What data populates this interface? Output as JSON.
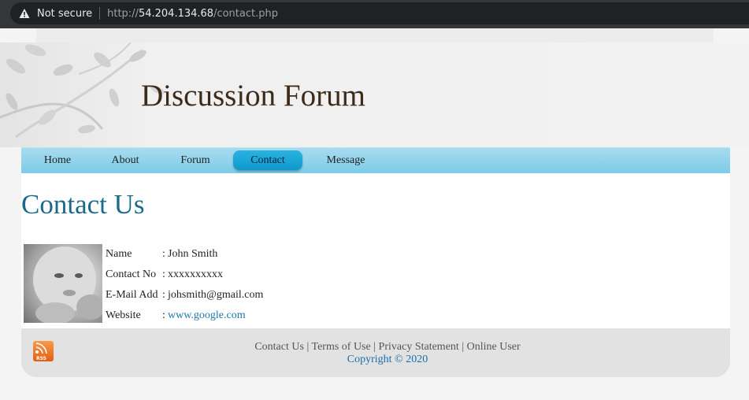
{
  "browser": {
    "security_label": "Not secure",
    "url_scheme": "http://",
    "url_host": "54.204.134.68",
    "url_path": "/contact.php"
  },
  "site": {
    "title": "Discussion Forum"
  },
  "nav": {
    "items": [
      {
        "label": "Home"
      },
      {
        "label": "About"
      },
      {
        "label": "Forum"
      },
      {
        "label": "Contact"
      },
      {
        "label": "Message"
      }
    ],
    "active": "Contact",
    "accent": "#1aa6d8"
  },
  "main": {
    "title": "Contact Us",
    "contact": {
      "name_label": "Name",
      "name_value": "John Smith",
      "phone_label": "Contact No",
      "phone_value": "xxxxxxxxxx",
      "email_label": "E-Mail Add",
      "email_value": "johsmith@gmail.com",
      "website_label": "Website",
      "website_value": "www.google.com",
      "separator": ":"
    }
  },
  "footer": {
    "links": [
      "Contact Us",
      "Terms of Use",
      "Privacy Statement",
      "Online User"
    ],
    "divider": "|",
    "copyright": "Copyright © 2020",
    "rss_label": "RSS"
  }
}
